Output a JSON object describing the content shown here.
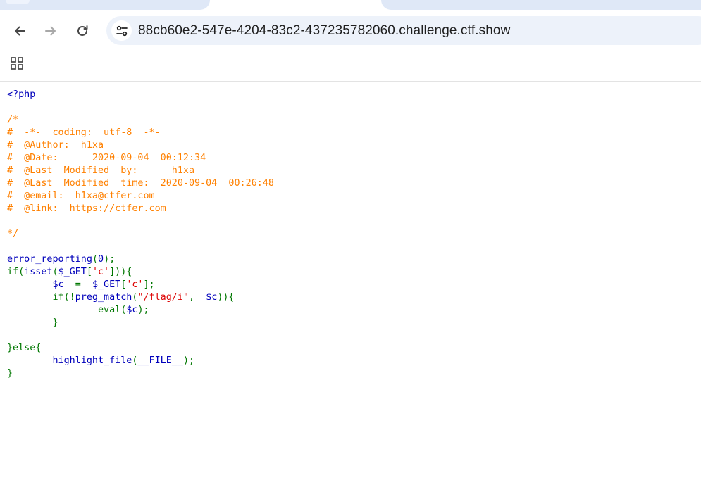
{
  "browser": {
    "address": "88cb60e2-547e-4204-83c2-437235782060.challenge.ctf.show",
    "icons": {
      "back": "arrow-left-icon",
      "forward": "arrow-right-icon",
      "reload": "reload-icon",
      "site_info": "tune-icon",
      "apps": "apps-grid-icon"
    }
  },
  "colors": {
    "default": "#0000bb",
    "comment": "#ff8000",
    "keyword": "#007700",
    "string": "#dd0000"
  },
  "code": {
    "lines": [
      [
        {
          "t": "<?php",
          "k": "default"
        }
      ],
      [],
      [
        {
          "t": "/*",
          "k": "comment"
        }
      ],
      [
        {
          "t": "#  -*-  coding:  utf-8  -*-",
          "k": "comment"
        }
      ],
      [
        {
          "t": "#  @Author:  h1xa",
          "k": "comment"
        }
      ],
      [
        {
          "t": "#  @Date:      2020-09-04  00:12:34",
          "k": "comment"
        }
      ],
      [
        {
          "t": "#  @Last  Modified  by:      h1xa",
          "k": "comment"
        }
      ],
      [
        {
          "t": "#  @Last  Modified  time:  2020-09-04  00:26:48",
          "k": "comment"
        }
      ],
      [
        {
          "t": "#  @email:  h1xa@ctfer.com",
          "k": "comment"
        }
      ],
      [
        {
          "t": "#  @link:  https://ctfer.com",
          "k": "comment"
        }
      ],
      [],
      [
        {
          "t": "*/",
          "k": "comment"
        }
      ],
      [],
      [
        {
          "t": "error_reporting",
          "k": "default"
        },
        {
          "t": "(",
          "k": "keyword"
        },
        {
          "t": "0",
          "k": "default"
        },
        {
          "t": ");",
          "k": "keyword"
        }
      ],
      [
        {
          "t": "if(",
          "k": "keyword"
        },
        {
          "t": "isset",
          "k": "default"
        },
        {
          "t": "(",
          "k": "keyword"
        },
        {
          "t": "$_GET",
          "k": "default"
        },
        {
          "t": "[",
          "k": "keyword"
        },
        {
          "t": "'c'",
          "k": "string"
        },
        {
          "t": "])){",
          "k": "keyword"
        }
      ],
      [
        {
          "t": "        ",
          "k": "keyword"
        },
        {
          "t": "$c  ",
          "k": "default"
        },
        {
          "t": "=  ",
          "k": "keyword"
        },
        {
          "t": "$_GET",
          "k": "default"
        },
        {
          "t": "[",
          "k": "keyword"
        },
        {
          "t": "'c'",
          "k": "string"
        },
        {
          "t": "];",
          "k": "keyword"
        }
      ],
      [
        {
          "t": "        if(!",
          "k": "keyword"
        },
        {
          "t": "preg_match",
          "k": "default"
        },
        {
          "t": "(",
          "k": "keyword"
        },
        {
          "t": "\"/flag/i\"",
          "k": "string"
        },
        {
          "t": ",  ",
          "k": "keyword"
        },
        {
          "t": "$c",
          "k": "default"
        },
        {
          "t": ")){",
          "k": "keyword"
        }
      ],
      [
        {
          "t": "                eval",
          "k": "keyword"
        },
        {
          "t": "(",
          "k": "keyword"
        },
        {
          "t": "$c",
          "k": "default"
        },
        {
          "t": ");",
          "k": "keyword"
        }
      ],
      [
        {
          "t": "        }",
          "k": "keyword"
        }
      ],
      [],
      [
        {
          "t": "}else{",
          "k": "keyword"
        }
      ],
      [
        {
          "t": "        ",
          "k": "keyword"
        },
        {
          "t": "highlight_file",
          "k": "default"
        },
        {
          "t": "(",
          "k": "keyword"
        },
        {
          "t": "__FILE__",
          "k": "default"
        },
        {
          "t": ");",
          "k": "keyword"
        }
      ],
      [
        {
          "t": "}",
          "k": "keyword"
        }
      ]
    ]
  }
}
